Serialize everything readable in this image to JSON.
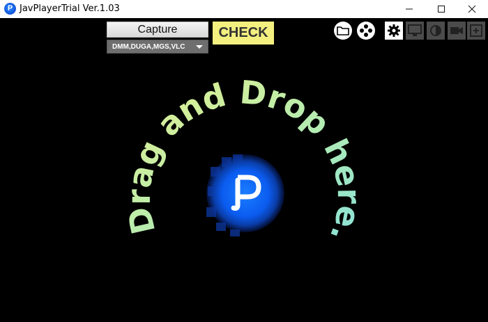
{
  "window": {
    "title": "JavPlayerTrial Ver.1.03",
    "app_icon_glyph": "P",
    "controls": [
      "minimize",
      "maximize",
      "close"
    ]
  },
  "toolbar": {
    "capture_label": "Capture",
    "source_selected": "DMM,DUGA,MGS,VLC",
    "check_label": "CHECK",
    "icons": [
      "folder-icon",
      "gamepad-icon",
      "settings-gear-icon",
      "monitor-icon",
      "contrast-icon",
      "video-camera-icon",
      "add-frame-icon"
    ]
  },
  "drop_zone": {
    "message": "Drag and Drop here.",
    "logo_letter": "P"
  },
  "colors": {
    "background": "#000000",
    "check_button": "#f3f080",
    "logo_blue": "#1a7dff",
    "text_gradient_start": "#e6f28c",
    "text_gradient_end": "#8ee6d9"
  }
}
